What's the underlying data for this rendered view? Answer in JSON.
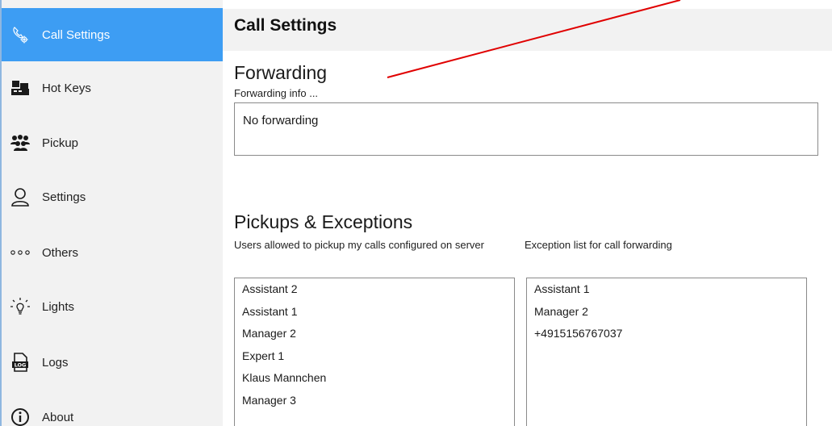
{
  "sidebar": {
    "items": [
      {
        "label": "Call Settings",
        "icon": "call-settings-icon",
        "active": true
      },
      {
        "label": "Hot Keys",
        "icon": "hotkeys-icon",
        "active": false
      },
      {
        "label": "Pickup",
        "icon": "pickup-group-icon",
        "active": false
      },
      {
        "label": "Settings",
        "icon": "user-settings-icon",
        "active": false
      },
      {
        "label": "Others",
        "icon": "dots-icon",
        "active": false
      },
      {
        "label": "Lights",
        "icon": "lightbulb-icon",
        "active": false
      },
      {
        "label": "Logs",
        "icon": "log-file-icon",
        "active": false
      },
      {
        "label": "About",
        "icon": "info-icon",
        "active": false
      }
    ]
  },
  "header": {
    "title": "Call Settings"
  },
  "forwarding": {
    "heading": "Forwarding",
    "info": "Forwarding info ...",
    "value": "No forwarding"
  },
  "pickups": {
    "heading": "Pickups & Exceptions",
    "allowed_caption": "Users allowed to pickup my calls configured on server",
    "exceptions_caption": "Exception list for call forwarding",
    "allowed_users": [
      "Assistant 2",
      "Assistant 1",
      "Manager 2",
      "Expert 1",
      "Klaus Mannchen",
      "Manager 3"
    ],
    "exception_list": [
      "Assistant 1",
      "Manager 2",
      "+4915156767037"
    ]
  },
  "colors": {
    "accent": "#3d9df3",
    "sidebar_bg": "#f2f2f2",
    "annotation_arrow": "#e00000"
  }
}
